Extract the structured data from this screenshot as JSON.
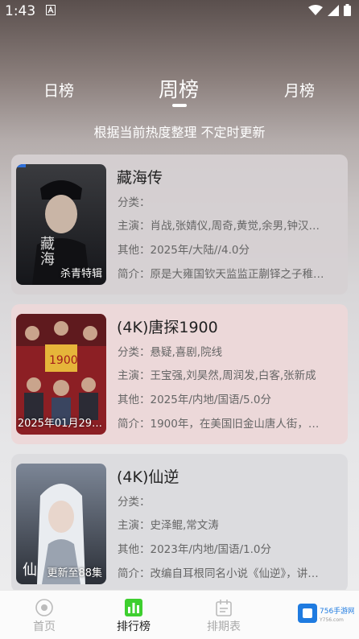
{
  "status_bar": {
    "time": "1:43"
  },
  "tabs": {
    "day": "日榜",
    "week": "周榜",
    "month": "月榜"
  },
  "subtitle": "根据当前热度整理 不定时更新",
  "labels": {
    "genre": "分类：",
    "cast": "主演：",
    "other": "其他：",
    "desc": "简介："
  },
  "cards": [
    {
      "title": "藏海传",
      "poster_label": "杀青特辑",
      "genre": "",
      "cast": "肖战,张婧仪,周奇,黄觉,余男,钟汉…",
      "other": "2025年/大陆//4.0分",
      "desc": "原是大雍国钦天监监正蒯铎之子稚…"
    },
    {
      "title": "(4K)唐探1900",
      "poster_label": "2025年01月29…",
      "genre": "悬疑,喜剧,院线",
      "cast": "王宝强,刘昊然,周润发,白客,张新成",
      "other": "2025年/内地/国语/5.0分",
      "desc": "1900年，在美国旧金山唐人街，…"
    },
    {
      "title": "(4K)仙逆",
      "poster_label": "更新至88集",
      "genre": "",
      "cast": "史泽鲲,常文涛",
      "other": "2023年/内地/国语/1.0分",
      "desc": "改编自耳根同名小说《仙逆》，讲…"
    }
  ],
  "bottom_nav": {
    "home": "首页",
    "rank": "排行榜",
    "schedule": "排期表"
  },
  "watermark": {
    "text": "756手游网"
  },
  "colors": {
    "accent_green": "#3ecf2f",
    "card_pink": "#ecd8d9"
  }
}
